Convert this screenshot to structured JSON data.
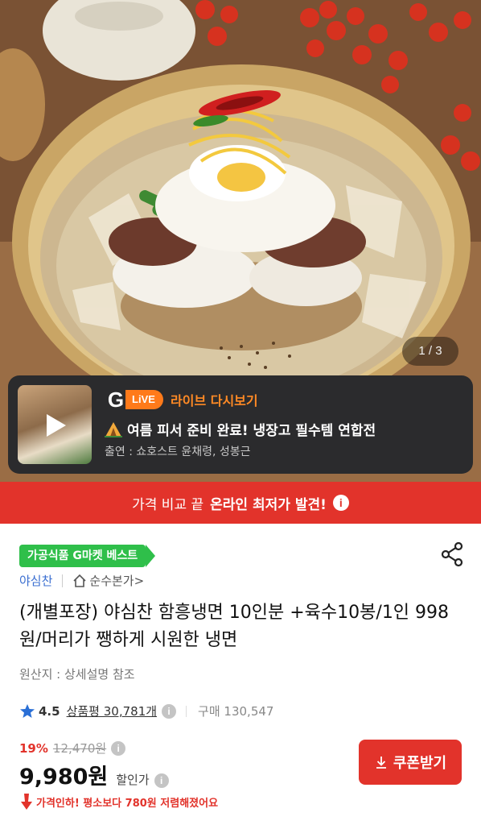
{
  "hero": {
    "image_name": "naengmyeon-bowl-photo",
    "page_counter": "1 / 3"
  },
  "live": {
    "brand_mark": "G",
    "badge": "LiVE",
    "replay_label": "라이브 다시보기",
    "title_icon": "tent-icon",
    "title": "여름 피서 준비 완료! 냉장고 필수템 연합전",
    "cast": "출연 : 쇼호스트 윤채령, 성봉근",
    "colors": {
      "accent": "#ff8a25",
      "card_bg": "#2b2b2d"
    }
  },
  "banner": {
    "prefix": "가격 비교 끝",
    "emphasis": "온라인 최저가 발견!",
    "info_icon": "i"
  },
  "product": {
    "best_badge": "가공식품 G마켓 베스트",
    "brand": "야심찬",
    "store": "순수본가",
    "store_chevron": ">",
    "title": "(개별포장) 야심찬 함흥냉면 10인분 +육수10봉/1인 998원/머리가 쨍하게 시원한 냉면",
    "origin": "원산지 : 상세설명 참조",
    "rating": "4.5",
    "review_label": "상품평 30,781개",
    "purchase_count": "구매 130,547",
    "discount_rate": "19%",
    "original_price": "12,470원",
    "sale_price": "9,980원",
    "discount_label": "할인가",
    "price_drop_note": "가격인하! 평소보다 780원 저렴해졌어요",
    "coupon_button": "쿠폰받기",
    "colors": {
      "brand_blue": "#3b6fd1",
      "sale_red": "#e2332b",
      "best_green": "#2fbf4a"
    }
  }
}
